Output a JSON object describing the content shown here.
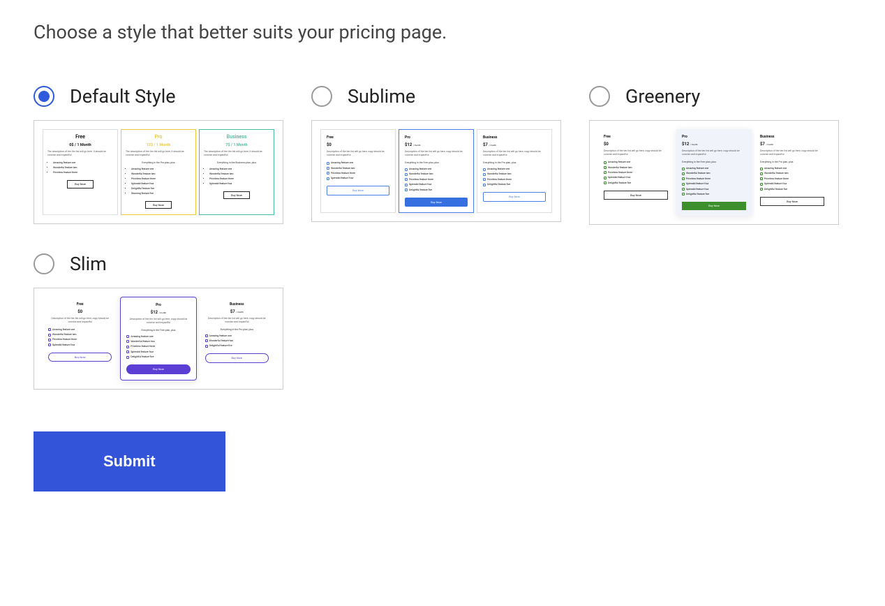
{
  "page_title": "Choose a style that better suits your pricing page.",
  "options": [
    {
      "id": "default",
      "label": "Default Style",
      "checked": true
    },
    {
      "id": "sublime",
      "label": "Sublime",
      "checked": false
    },
    {
      "id": "greenery",
      "label": "Greenery",
      "checked": false
    },
    {
      "id": "slim",
      "label": "Slim",
      "checked": false
    }
  ],
  "preview_default": {
    "tiers": [
      {
        "name": "Free",
        "price": "0$ / 1 Month",
        "desc": "The description of the tier list will go here. It should be concise and impactful",
        "features": [
          "Amazing feature one",
          "Wonderful feature two",
          "Priceless feature three"
        ],
        "btn": "Buy Now"
      },
      {
        "name": "Pro",
        "price": "12$ / 1 Month",
        "desc": "The description of the tier list will go here, it should be concise and impactful",
        "sub": "Everything in the Pro plan, plus",
        "features": [
          "Amazing feature one",
          "Wonderful feature two",
          "Priceless feature three",
          "Splendid feature four",
          "Delightful feature five",
          "Stunning feature five"
        ],
        "btn": "Buy Now"
      },
      {
        "name": "Business",
        "price": "7$ / 1 Month",
        "desc": "The description of the tier list will go here, it should be concise and impactful",
        "sub": "Everything in the Business plan, plus",
        "features": [
          "Amazing feature one",
          "Wonderful feature two",
          "Priceless feature three",
          "Splendid feature four"
        ],
        "btn": "Buy Now"
      }
    ]
  },
  "preview_sublime": {
    "tiers": [
      {
        "name": "Free",
        "price": "$0",
        "desc": "Description of the tier list will go here, copy should be concise and impactful",
        "features": [
          "Amazing feature one",
          "Wonderful feature two",
          "Priceless feature three",
          "Splendid feature four"
        ],
        "btn": "Buy Now"
      },
      {
        "name": "Pro",
        "price": "$12",
        "period": "/ month",
        "desc": "Description of the tier list will go here, copy should be concise and impactful",
        "sub": "Everything in the Free plan, plus",
        "features": [
          "Amazing feature one",
          "Wonderful feature two",
          "Priceless feature three",
          "Splendid feature four",
          "Delightful feature five"
        ],
        "btn": "Buy Now"
      },
      {
        "name": "Business",
        "price": "$7",
        "period": "/ month",
        "desc": "Description of the tier list will go here, copy should be concise and impactful",
        "sub": "Everything in the Pro plan, plus",
        "features": [
          "Amazing feature one",
          "Wonderful feature two",
          "Priceless feature three",
          "Delightful feature five"
        ],
        "btn": "Buy Now"
      }
    ]
  },
  "preview_greenery": {
    "tiers": [
      {
        "name": "Free",
        "price": "$0",
        "desc": "Description of the tier list will go here, copy should be concise and impactful",
        "features": [
          "Amazing feature one",
          "Wonderful feature two",
          "Priceless feature three",
          "Splendid feature four",
          "Delightful feature five"
        ],
        "btn": "Buy Now"
      },
      {
        "name": "Pro",
        "price": "$12",
        "period": "/ month",
        "desc": "Description of the tier list will go here, copy should be concise and impactful",
        "sub": "Everything in the Free plan, plus",
        "features": [
          "Amazing feature one",
          "Wonderful feature two",
          "Priceless feature three",
          "Splendid feature four",
          "Splendid feature four",
          "Delightful feature five"
        ],
        "btn": "Buy Now"
      },
      {
        "name": "Business",
        "price": "$7",
        "period": "/ month",
        "desc": "Description of the tier list will go here, copy should be concise and impactful",
        "sub": "Everything in the Pro plan, plus",
        "features": [
          "Amazing feature one",
          "Wonderful feature two",
          "Priceless feature three",
          "Splendid feature four",
          "Delightful feature five"
        ],
        "btn": "Buy Now"
      }
    ]
  },
  "preview_slim": {
    "tiers": [
      {
        "name": "Free",
        "price": "$0",
        "desc": "Description of the tier list will go here, copy should be concise and impactful",
        "features": [
          "Amazing feature one",
          "Wonderful feature two",
          "Priceless feature three",
          "Splendid feature four"
        ],
        "btn": "Buy Now"
      },
      {
        "name": "Pro",
        "price": "$12",
        "period": "/ month",
        "desc": "Description of the tier list will go here, copy should be concise and impactful",
        "sub": "Everything in the Free plan, plus",
        "features": [
          "Amazing feature one",
          "Wonderful feature two",
          "Priceless feature three",
          "Splendid feature four",
          "Delightful feature five"
        ],
        "btn": "Buy Now"
      },
      {
        "name": "Business",
        "price": "$7",
        "period": "/ month",
        "desc": "Description of the tier list will go here, copy should be concise and impactful",
        "sub": "Everything in the Pro plan, plus",
        "features": [
          "Amazing feature one",
          "Wonderful feature two",
          "Delightful feature five"
        ],
        "btn": "Buy Now"
      }
    ]
  },
  "submit_label": "Submit"
}
